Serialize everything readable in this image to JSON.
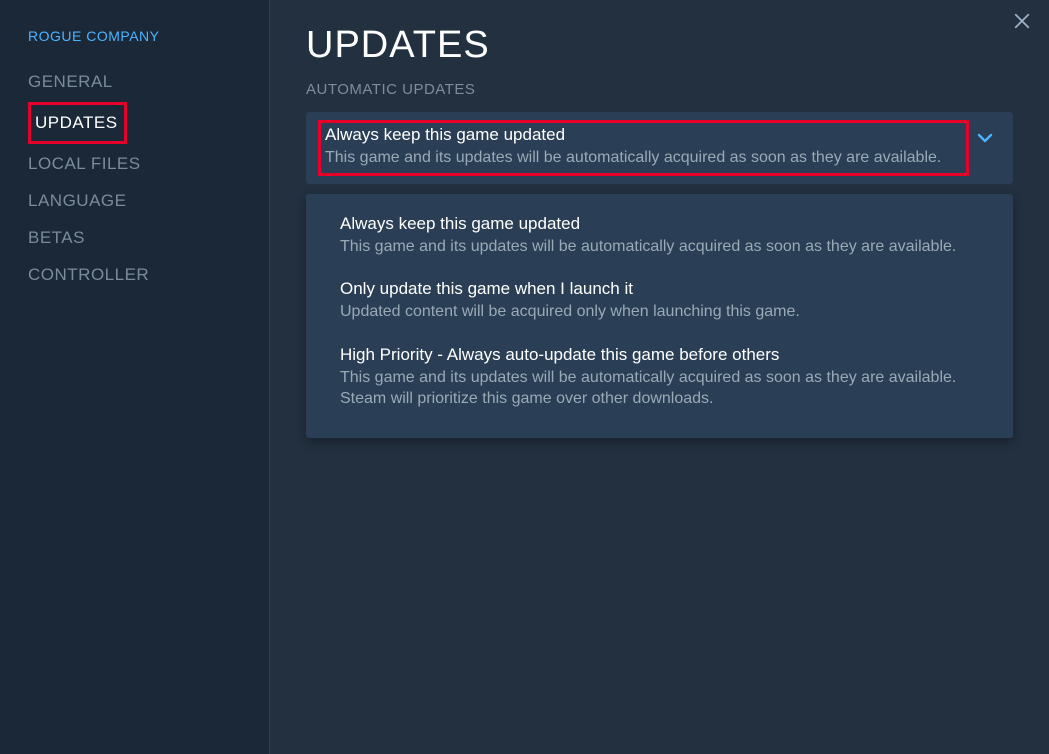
{
  "sidebar": {
    "game_title": "ROGUE COMPANY",
    "items": [
      {
        "label": "GENERAL"
      },
      {
        "label": "UPDATES"
      },
      {
        "label": "LOCAL FILES"
      },
      {
        "label": "LANGUAGE"
      },
      {
        "label": "BETAS"
      },
      {
        "label": "CONTROLLER"
      }
    ]
  },
  "main": {
    "page_title": "UPDATES",
    "section_label": "AUTOMATIC UPDATES",
    "selected": {
      "title": "Always keep this game updated",
      "desc": "This game and its updates will be automatically acquired as soon as they are available."
    },
    "options": [
      {
        "title": "Always keep this game updated",
        "desc": "This game and its updates will be automatically acquired as soon as they are available."
      },
      {
        "title": "Only update this game when I launch it",
        "desc": "Updated content will be acquired only when launching this game."
      },
      {
        "title": "High Priority - Always auto-update this game before others",
        "desc": "This game and its updates will be automatically acquired as soon as they are available. Steam will prioritize this game over other downloads."
      }
    ]
  }
}
